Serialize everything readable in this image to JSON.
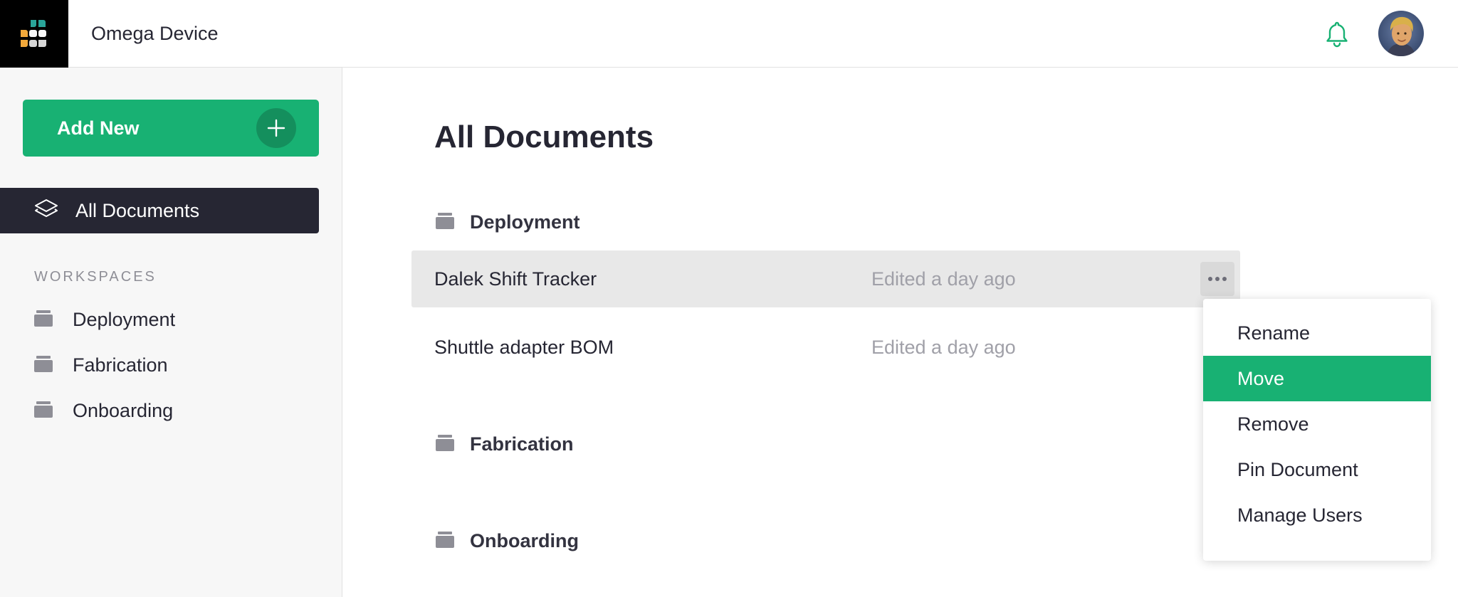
{
  "app": {
    "org_name": "Omega Device",
    "accent_color": "#18b173",
    "sidebar_dark_color": "#262633"
  },
  "sidebar": {
    "add_new_label": "Add New",
    "all_documents_label": "All Documents",
    "workspaces_heading": "WORKSPACES",
    "workspaces": [
      {
        "label": "Deployment",
        "icon": "folder-icon"
      },
      {
        "label": "Fabrication",
        "icon": "folder-icon"
      },
      {
        "label": "Onboarding",
        "icon": "folder-icon"
      }
    ]
  },
  "header": {
    "notification_icon": "bell-icon",
    "avatar": "user-avatar"
  },
  "main": {
    "title": "All Documents",
    "sections": [
      {
        "name": "Deployment",
        "documents": [
          {
            "name": "Dalek Shift Tracker",
            "edited": "Edited a day ago"
          },
          {
            "name": "Shuttle adapter BOM",
            "edited": "Edited a day ago"
          }
        ]
      },
      {
        "name": "Fabrication",
        "documents": []
      },
      {
        "name": "Onboarding",
        "documents": []
      }
    ]
  },
  "context_menu": {
    "items": [
      {
        "label": "Rename"
      },
      {
        "label": "Move",
        "selected": true
      },
      {
        "label": "Remove"
      },
      {
        "label": "Pin Document"
      },
      {
        "label": "Manage Users"
      }
    ]
  }
}
